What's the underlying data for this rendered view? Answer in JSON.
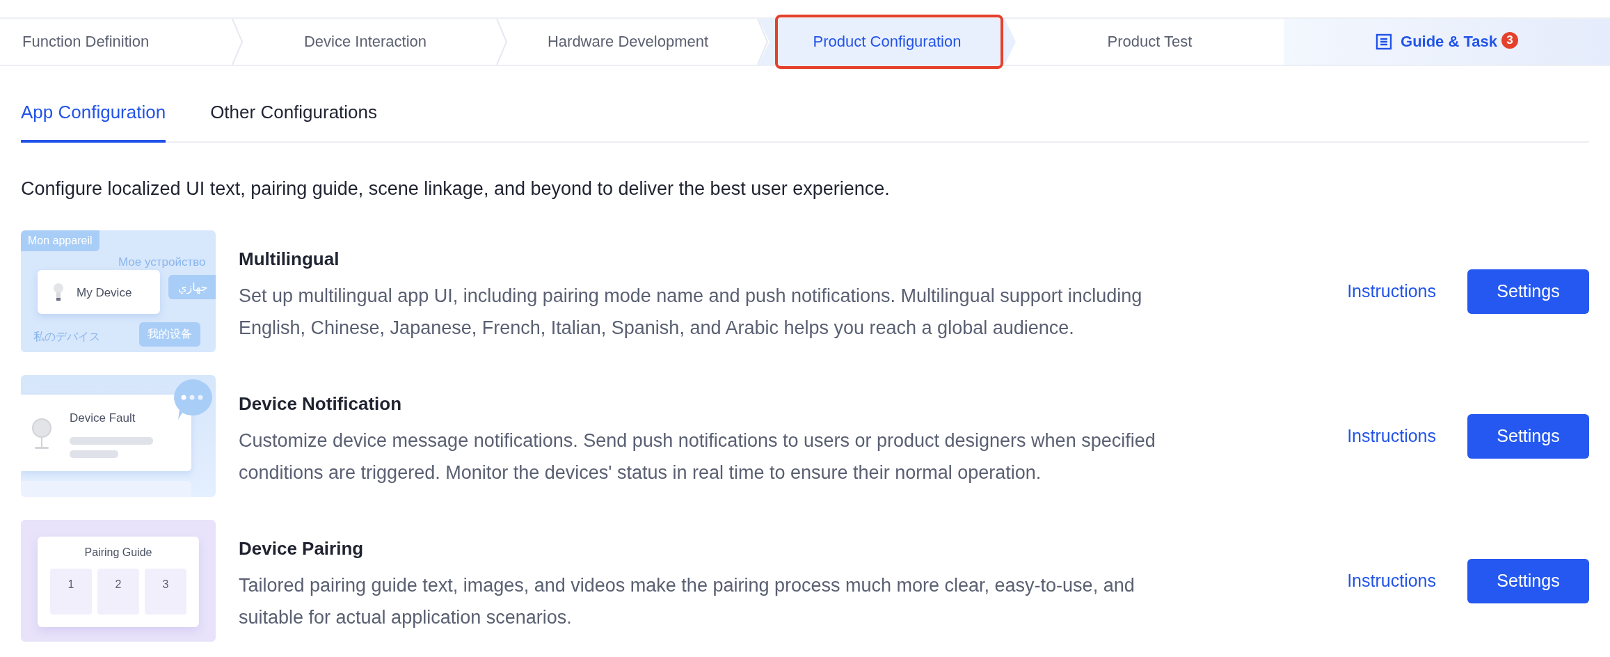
{
  "steps": [
    {
      "label": "Function Definition",
      "selected": false,
      "highlighted": false
    },
    {
      "label": "Device Interaction",
      "selected": false,
      "highlighted": false
    },
    {
      "label": "Hardware Development",
      "selected": false,
      "highlighted": false
    },
    {
      "label": "Product Configuration",
      "selected": true,
      "highlighted": true
    },
    {
      "label": "Product Test",
      "selected": false,
      "highlighted": false
    }
  ],
  "guide": {
    "label": "Guide & Task",
    "badge": "3"
  },
  "tabs": [
    {
      "label": "App Configuration",
      "selected": true
    },
    {
      "label": "Other Configurations",
      "selected": false
    }
  ],
  "intro": "Configure localized UI text, pairing guide, scene linkage, and beyond to deliver the best user experience.",
  "features": [
    {
      "kind": "multilingual",
      "title": "Multilingual",
      "description": "Set up multilingual app UI, including pairing mode name and push notifications. Multilingual support including English, Chinese, Japanese, French, Italian, Spanish, and Arabic helps you reach a global audience.",
      "link": "Instructions",
      "button": "Settings",
      "illustration": {
        "french": "Mon appareil",
        "russian": "Мое устройство",
        "device": "My Device",
        "arabic": "جهازي",
        "japanese": "私のデバイス",
        "chinese": "我的设备"
      }
    },
    {
      "kind": "notification",
      "title": "Device Notification",
      "description": "Customize device message notifications. Send push notifications to users or product designers when specified conditions are triggered. Monitor the devices' status in real time to ensure their normal operation.",
      "link": "Instructions",
      "button": "Settings",
      "illustration": {
        "title": "Device Fault"
      }
    },
    {
      "kind": "pairing",
      "title": "Device Pairing",
      "description": "Tailored pairing guide text, images, and videos make the pairing process much more clear, easy-to-use, and suitable for actual application scenarios.",
      "link": "Instructions",
      "button": "Settings",
      "illustration": {
        "title": "Pairing Guide",
        "steps": [
          "1",
          "2",
          "3"
        ]
      }
    }
  ]
}
